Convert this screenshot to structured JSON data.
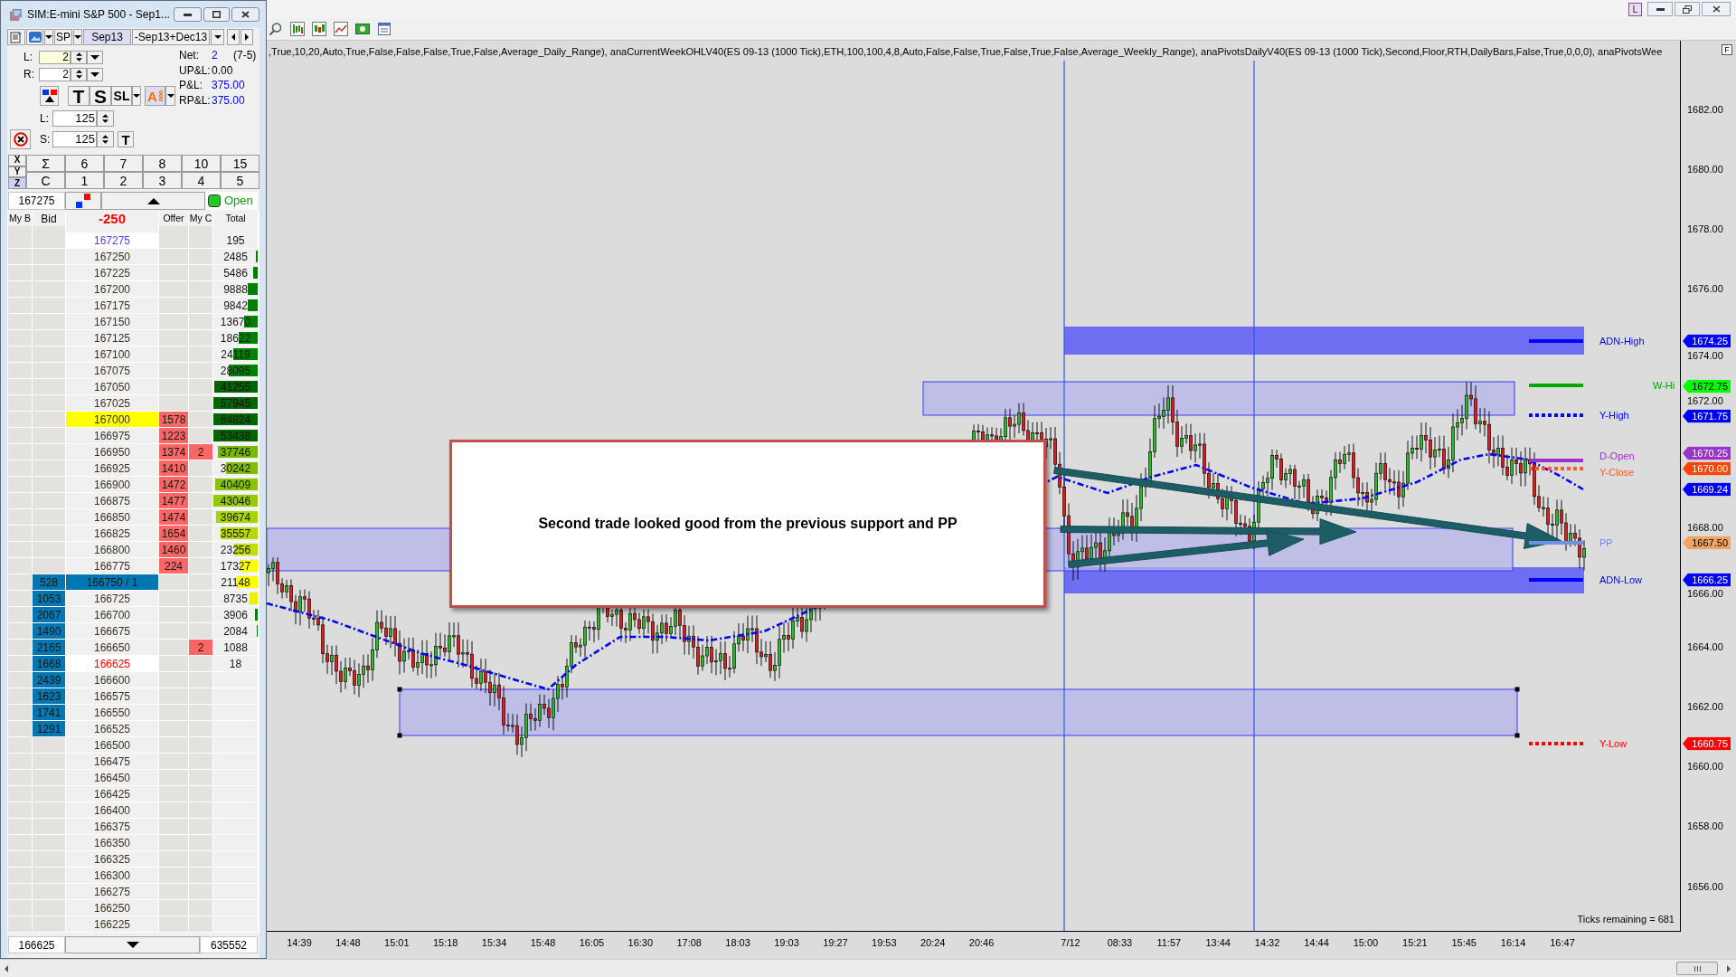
{
  "dom": {
    "title": "SIM:E-mini S&P 500 - Sep1...",
    "instrument": "SP",
    "contract": "Sep13",
    "spread": "-Sep13+Dec13",
    "qty_fields": [
      {
        "label": "L:",
        "value": "2"
      },
      {
        "label": "R:",
        "value": "2"
      }
    ],
    "stats": [
      {
        "label": "Net:",
        "value": "2",
        "note": "(7-5)",
        "color": "#0000ff"
      },
      {
        "label": "UP&L:",
        "value": "0.00",
        "color": "#000000"
      },
      {
        "label": "P&L:",
        "value": "375.00",
        "color": "#0000ff"
      },
      {
        "label": "RP&L:",
        "value": "375.00",
        "color": "#0000ff"
      }
    ],
    "action_buttons": [
      {
        "label": "T",
        "kind": "plain",
        "dropdown": false,
        "color": "#000000"
      },
      {
        "label": "S",
        "kind": "plain",
        "dropdown": false,
        "color": "#000000"
      },
      {
        "label": "SL",
        "kind": "plain",
        "dropdown": true,
        "color": "#000000"
      },
      {
        "label": "A",
        "kind": "auto",
        "dropdown": true,
        "color": "#ff6a00"
      }
    ],
    "bracket_fields": [
      {
        "label": "L:",
        "value": "125"
      },
      {
        "label": "S:",
        "value": "125"
      }
    ],
    "target_button": "T",
    "axis_selectors": [
      {
        "label": "X",
        "selected": false
      },
      {
        "label": "Y",
        "selected": false
      },
      {
        "label": "Z",
        "selected": true
      }
    ],
    "quantity_rows": [
      [
        "Σ",
        "6",
        "7",
        "8",
        "10",
        "15"
      ],
      [
        "C",
        "1",
        "2",
        "3",
        "4",
        "5"
      ]
    ],
    "top_price": "167275",
    "status": {
      "label": "Open",
      "on": true
    },
    "columns": [
      {
        "label": "My B",
        "emphasis": false
      },
      {
        "label": "Bid",
        "emphasis": false
      },
      {
        "label": "-250",
        "emphasis": true
      },
      {
        "label": "Offer",
        "emphasis": false
      },
      {
        "label": "My C",
        "emphasis": false
      },
      {
        "label": "Total",
        "emphasis": false
      }
    ],
    "rows": [
      {
        "price": "167275",
        "total": "195",
        "kind": "high"
      },
      {
        "price": "167250",
        "total": "2485",
        "level": 0.04,
        "color": "#008000",
        "kind": "plain"
      },
      {
        "price": "167225",
        "total": "5486",
        "level": 0.1,
        "color": "#008000",
        "kind": "plain"
      },
      {
        "price": "167200",
        "total": "9888",
        "level": 0.22,
        "color": "#008000",
        "kind": "plain"
      },
      {
        "price": "167175",
        "total": "9842",
        "level": 0.22,
        "color": "#008000",
        "kind": "plain"
      },
      {
        "price": "167150",
        "total": "13670",
        "level": 0.3,
        "color": "#008000",
        "kind": "plain"
      },
      {
        "price": "167125",
        "total": "18622",
        "level": 0.42,
        "color": "#008000",
        "kind": "plain"
      },
      {
        "price": "167100",
        "total": "24119",
        "level": 0.56,
        "color": "#008000",
        "kind": "plain"
      },
      {
        "price": "167075",
        "total": "28095",
        "level": 0.65,
        "color": "#008000",
        "kind": "plain"
      },
      {
        "price": "167050",
        "total": "41255",
        "level": 0.97,
        "color": "#006400",
        "kind": "plain"
      },
      {
        "price": "167025",
        "total": "57945",
        "level": 1,
        "color": "#006400",
        "kind": "plain"
      },
      {
        "price": "167000",
        "offer": "1578",
        "total": "64824",
        "level": 1,
        "color": "#006400",
        "kind": "entry"
      },
      {
        "price": "166975",
        "offer": "1223",
        "total": "53438",
        "level": 1,
        "color": "#006400",
        "kind": "plain"
      },
      {
        "price": "166950",
        "offer": "1374",
        "my_c": "2",
        "total": "37746",
        "level": 0.89,
        "color": "#78b800",
        "kind": "plain"
      },
      {
        "price": "166925",
        "offer": "1410",
        "total": "30242",
        "level": 0.72,
        "color": "#80bc00",
        "kind": "plain"
      },
      {
        "price": "166900",
        "offer": "1472",
        "total": "40409",
        "level": 0.96,
        "color": "#88c400",
        "kind": "plain"
      },
      {
        "price": "166875",
        "offer": "1477",
        "total": "43046",
        "level": 1,
        "color": "#94ca00",
        "kind": "plain"
      },
      {
        "price": "166850",
        "offer": "1474",
        "total": "39674",
        "level": 0.93,
        "color": "#a8d400",
        "kind": "plain"
      },
      {
        "price": "166825",
        "offer": "1654",
        "total": "35557",
        "level": 0.83,
        "color": "#b4d800",
        "kind": "plain"
      },
      {
        "price": "166800",
        "offer": "1460",
        "total": "23256",
        "level": 0.53,
        "color": "#c0dc00",
        "kind": "plain"
      },
      {
        "price": "166775",
        "offer": "224",
        "total": "17327",
        "level": 0.4,
        "color": "#ffff00",
        "kind": "plain"
      },
      {
        "price": "166750 / 1",
        "bid": "528",
        "total": "21148",
        "level": 0.48,
        "color": "#ffff00",
        "kind": "last"
      },
      {
        "price": "166725",
        "bid": "1053",
        "total": "8735",
        "level": 0.18,
        "color": "#eeee00",
        "kind": "plain"
      },
      {
        "price": "166700",
        "bid": "2067",
        "total": "3906",
        "level": 0.06,
        "color": "#008000",
        "kind": "plain"
      },
      {
        "price": "166675",
        "bid": "1490",
        "total": "2084",
        "level": 0.02,
        "color": "#008000",
        "kind": "plain"
      },
      {
        "price": "166650",
        "bid": "2165",
        "my_c": "2",
        "total": "1088",
        "kind": "plain"
      },
      {
        "price": "166625",
        "bid": "1668",
        "total": "18",
        "kind": "low"
      },
      {
        "price": "166600",
        "bid": "2439",
        "kind": "plain"
      },
      {
        "price": "166575",
        "bid": "1623",
        "kind": "plain"
      },
      {
        "price": "166550",
        "bid": "1741",
        "kind": "plain"
      },
      {
        "price": "166525",
        "bid": "1291",
        "kind": "plain"
      },
      {
        "price": "166500",
        "kind": "plain"
      },
      {
        "price": "166475",
        "kind": "plain"
      },
      {
        "price": "166450",
        "kind": "plain"
      },
      {
        "price": "166425",
        "kind": "plain"
      },
      {
        "price": "166400",
        "kind": "plain"
      },
      {
        "price": "166375",
        "kind": "plain"
      },
      {
        "price": "166350",
        "kind": "plain"
      },
      {
        "price": "166325",
        "kind": "plain"
      },
      {
        "price": "166300",
        "kind": "plain"
      },
      {
        "price": "166275",
        "kind": "plain"
      },
      {
        "price": "166250",
        "kind": "plain"
      },
      {
        "price": "166225",
        "kind": "plain"
      }
    ],
    "bottom_price": "166625",
    "total_volume": "635552"
  },
  "chart": {
    "mode_button": "L",
    "side_button": "F",
    "indicator_text": ",True,10,20,Auto,True,False,False,False,True,False,Average_Daily_Range), anaCurrentWeekOHLV40(ES 09-13 (1000 Tick),ETH,100,100,4,8,Auto,False,False,True,False,True,False,Average_Weekly_Range), anaPivotsDailyV40(ES 09-13 (1000 Tick),Second,Floor,RTH,DailyBars,False,True,0,0,0), anaPivotsWee",
    "annotation": "Second trade looked good from the previous support and PP",
    "levels": [
      {
        "label": "ADN-High",
        "color": "#0000ff",
        "dotted": false
      },
      {
        "label": "W-Hi",
        "color": "#00a800",
        "dotted": false
      },
      {
        "label": "Y-High",
        "color": "#0000ff",
        "dotted": true
      },
      {
        "label": "D-Open",
        "color": "#9933cc",
        "dotted": false
      },
      {
        "label": "Y-Close",
        "color": "#ff5a28",
        "dotted": true
      },
      {
        "label": "PP",
        "color": "#6f8fe8",
        "dotted": false
      },
      {
        "label": "ADN-Low",
        "color": "#0000ff",
        "dotted": false
      },
      {
        "label": "Y-Low",
        "color": "#ff0000",
        "dotted": true
      }
    ],
    "price_ticks": [
      "1682.00",
      "1680.00",
      "1678.00",
      "1676.00",
      "1674.00",
      "1672.00",
      "1668.00",
      "1666.00",
      "1664.00",
      "1662.00",
      "1660.00",
      "1658.00",
      "1656.00"
    ],
    "price_tags": [
      {
        "text": "1674.25",
        "color": "#0000ff"
      },
      {
        "text": "1672.75",
        "color": "#00ff00"
      },
      {
        "text": "1671.75",
        "color": "#0000ff"
      },
      {
        "text": "1670.25",
        "color": "#9933cc"
      },
      {
        "text": "1670.00",
        "color": "#ff4500"
      },
      {
        "text": "1669.24",
        "color": "#0000ff"
      },
      {
        "text": "1667.50",
        "color": "#f4a460"
      },
      {
        "text": "1666.25",
        "color": "#0000ff"
      },
      {
        "text": "1660.75",
        "color": "#ff0000"
      }
    ],
    "time_labels": [
      "14:39",
      "14:48",
      "15:01",
      "15:18",
      "15:34",
      "15:48",
      "16:05",
      "16:30",
      "17:08",
      "18:03",
      "19:03",
      "19:27",
      "19:53",
      "20:24",
      "20:46",
      "7/12",
      "08:33",
      "11:57",
      "13:44",
      "14:32",
      "14:44",
      "15:00",
      "15:21",
      "15:45",
      "16:14",
      "16:47"
    ],
    "ticks_remaining": "Ticks remaining = 681"
  }
}
